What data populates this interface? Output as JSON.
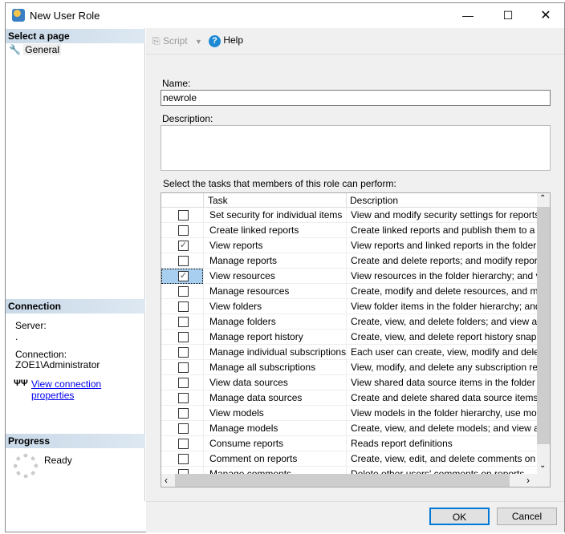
{
  "window": {
    "title": "New User Role",
    "minimize_icon": "minimize-icon",
    "maximize_icon": "maximize-icon",
    "close_icon": "close-icon"
  },
  "left": {
    "select_page_header": "Select a page",
    "pages": [
      {
        "label": "General",
        "icon": "wrench-icon"
      }
    ],
    "connection_header": "Connection",
    "server_label": "Server:",
    "server_value": ".",
    "connection_label": "Connection:",
    "connection_value": "ZOE1\\Administrator",
    "view_connection_link": "View connection properties",
    "progress_header": "Progress",
    "progress_status": "Ready"
  },
  "toolbar": {
    "script_label": "Script",
    "help_label": "Help"
  },
  "form": {
    "name_label": "Name:",
    "name_value": "newrole",
    "description_label": "Description:",
    "description_value": "",
    "tasks_label": "Select the tasks that members of this role can perform:"
  },
  "grid": {
    "columns": [
      "Task",
      "Description"
    ],
    "rows": [
      {
        "task": "Set security for individual items",
        "description": "View and modify security settings for reports, fold...",
        "checked": false
      },
      {
        "task": "Create linked reports",
        "description": "Create linked reports and publish them to a report",
        "checked": false
      },
      {
        "task": "View reports",
        "description": "View reports and linked reports in the folder hiera...",
        "checked": true
      },
      {
        "task": "Manage reports",
        "description": "Create and delete reports; and modify report prop",
        "checked": false
      },
      {
        "task": "View resources",
        "description": "View resources in the folder hierarchy; and view r",
        "checked": true,
        "selected": true
      },
      {
        "task": "Manage resources",
        "description": "Create, modify and delete resources, and modify ...",
        "checked": false
      },
      {
        "task": "View folders",
        "description": "View folder items in the folder hierarchy; and vie...",
        "checked": false
      },
      {
        "task": "Manage folders",
        "description": "Create, view, and delete folders; and view and m",
        "checked": false
      },
      {
        "task": "Manage report history",
        "description": "Create, view, and delete report history snapshots...",
        "checked": false
      },
      {
        "task": "Manage individual subscriptions",
        "description": "Each user can create, view, modify and delete s...",
        "checked": false
      },
      {
        "task": "Manage all subscriptions",
        "description": "View, modify, and delete any subscription regardl...",
        "checked": false
      },
      {
        "task": "View data sources",
        "description": "View shared data source items in the folder hierar",
        "checked": false
      },
      {
        "task": "Manage data sources",
        "description": "Create and delete shared data source items; and...",
        "checked": false
      },
      {
        "task": "View models",
        "description": "View models in the folder hierarchy, use models a",
        "checked": false
      },
      {
        "task": "Manage models",
        "description": "Create, view, and delete models; and view and ...",
        "checked": false
      },
      {
        "task": "Consume reports",
        "description": "Reads report definitions",
        "checked": false
      },
      {
        "task": "Comment on reports",
        "description": "Create, view, edit, and delete comments on repor",
        "checked": false
      },
      {
        "task": "Manage comments",
        "description": "Delete other users' comments on reports",
        "checked": false
      }
    ]
  },
  "buttons": {
    "ok": "OK",
    "cancel": "Cancel"
  },
  "colors": {
    "selected_row": "#a8cfef",
    "section_header": "#c9d9e8",
    "link": "#0000ee",
    "help": "#1e8ad6"
  }
}
